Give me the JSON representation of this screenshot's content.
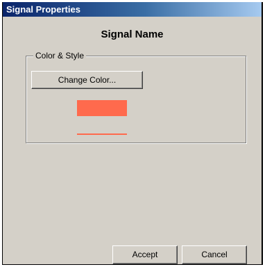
{
  "window": {
    "title": "Signal Properties"
  },
  "signal_name": "Signal Name",
  "color_style": {
    "group_label": "Color & Style",
    "change_color_label": "Change Color...",
    "signal_color": "#ff6a4d"
  },
  "footer": {
    "accept_label": "Accept",
    "cancel_label": "Cancel"
  }
}
